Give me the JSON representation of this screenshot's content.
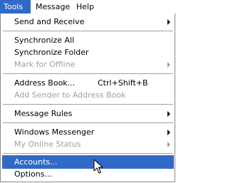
{
  "menubar": {
    "items": [
      {
        "label": "Tools"
      },
      {
        "label": "Message"
      },
      {
        "label": "Help"
      }
    ]
  },
  "menu": {
    "send_and_receive": {
      "label": "Send and Receive",
      "submenu": true
    },
    "synchronize_all": {
      "label": "Synchronize All"
    },
    "synchronize_folder": {
      "label": "Synchronize Folder"
    },
    "mark_for_offline": {
      "label": "Mark for Offline",
      "disabled": true,
      "submenu": true
    },
    "address_book": {
      "label": "Address Book...",
      "shortcut": "Ctrl+Shift+B"
    },
    "add_sender": {
      "label": "Add Sender to Address Book",
      "disabled": true
    },
    "message_rules": {
      "label": "Message Rules",
      "submenu": true
    },
    "windows_messenger": {
      "label": "Windows Messenger",
      "submenu": true
    },
    "my_online_status": {
      "label": "My Online Status",
      "disabled": true,
      "submenu": true
    },
    "accounts": {
      "label": "Accounts...",
      "highlighted": true
    },
    "options": {
      "label": "Options..."
    }
  },
  "colors": {
    "highlight": "#316ac5",
    "disabled_text": "#a0a0a0"
  },
  "icons": {
    "submenu_arrow": "chevron-right-icon",
    "pointer": "mouse-cursor-icon"
  }
}
